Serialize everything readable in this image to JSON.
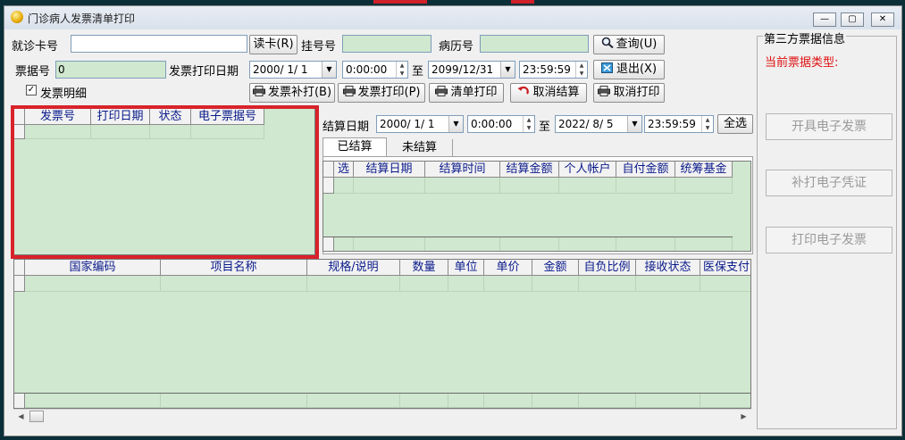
{
  "window": {
    "title": "门诊病人发票清单打印",
    "min_label": "—",
    "max_label": "▢",
    "close_label": "✕"
  },
  "form": {
    "card_label": "就诊卡号",
    "card_value": "",
    "read_card_button": "读卡(R)",
    "reg_label": "挂号号",
    "reg_value": "",
    "record_label": "病历号",
    "record_value": "",
    "query_button": "查询(U)",
    "invoice_label": "票据号",
    "invoice_value": "0",
    "print_date_label": "发票打印日期",
    "print_date_from": "2000/ 1/ 1",
    "print_time_from": "0:00:00",
    "to_label": "至",
    "print_date_to": "2099/12/31",
    "print_time_to": "23:59:59",
    "exit_button": "退出(X)",
    "detail_checkbox_label": "发票明细",
    "detail_checked": true
  },
  "actions": {
    "reprint_invoice": "发票补打(B)",
    "print_invoice": "发票打印(P)",
    "print_list": "清单打印",
    "cancel_settle": "取消结算",
    "cancel_print": "取消打印"
  },
  "invoice_grid": {
    "columns": [
      "发票号",
      "打印日期",
      "状态",
      "电子票据号"
    ]
  },
  "settle": {
    "date_label": "结算日期",
    "date_from": "2000/ 1/ 1",
    "time_from": "0:00:00",
    "to_label": "至",
    "date_to": "2022/ 8/ 5",
    "time_to": "23:59:59",
    "select_all_button": "全选",
    "tabs": [
      "已结算",
      "未结算"
    ],
    "columns": [
      "选",
      "结算日期",
      "结算时间",
      "结算金额",
      "个人帐户",
      "自付金额",
      "统筹基金"
    ]
  },
  "items_grid": {
    "columns": [
      "国家编码",
      "项目名称",
      "规格/说明",
      "数量",
      "单位",
      "单价",
      "金额",
      "自负比例",
      "接收状态",
      "医保支付"
    ]
  },
  "third_party": {
    "title": "第三方票据信息",
    "type_label": "当前票据类型:",
    "open_button": "开具电子发票",
    "reprint_button": "补打电子凭证",
    "print_button": "打印电子发票"
  },
  "colors": {
    "grid_bg": "#cfe8cf",
    "header_text": "#0a1a8a",
    "highlight": "#d8232a",
    "type_label": "#e01010"
  },
  "icons": {
    "title": "app-icon",
    "query": "magnifier-icon",
    "exit": "exit-icon",
    "print": "printer-icon",
    "cancel_settle": "undo-icon"
  }
}
